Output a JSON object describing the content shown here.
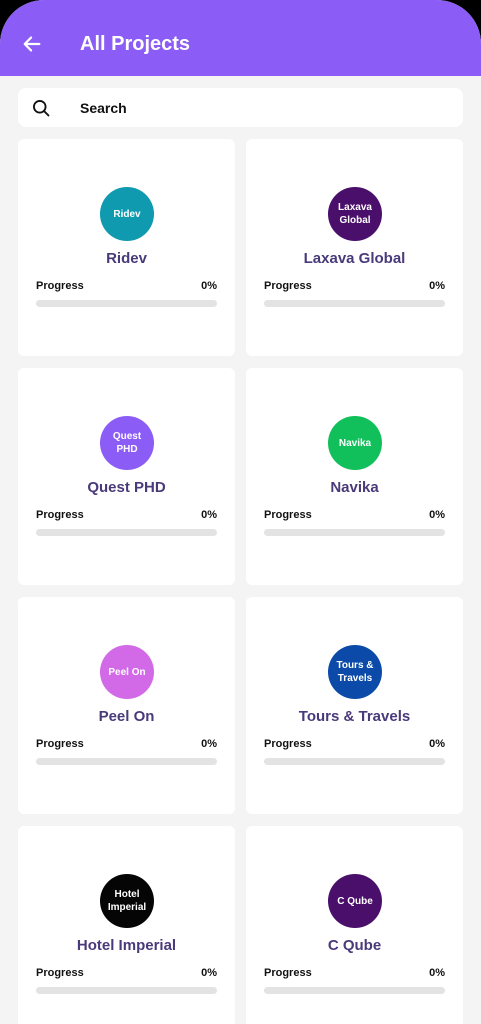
{
  "header": {
    "title": "All Projects"
  },
  "search": {
    "placeholder": "Search",
    "value": ""
  },
  "projects": [
    {
      "avatar_text": "Ridev",
      "name": "Ridev",
      "progress_label": "Progress",
      "progress_text": "0%",
      "progress": 0,
      "color": "#0f9aaf"
    },
    {
      "avatar_text": "Laxava Global",
      "name": "Laxava Global",
      "progress_label": "Progress",
      "progress_text": "0%",
      "progress": 0,
      "color": "#4a0f6b"
    },
    {
      "avatar_text": "Quest PHD",
      "name": "Quest PHD",
      "progress_label": "Progress",
      "progress_text": "0%",
      "progress": 0,
      "color": "#8b5cf6"
    },
    {
      "avatar_text": "Navika",
      "name": "Navika",
      "progress_label": "Progress",
      "progress_text": "0%",
      "progress": 0,
      "color": "#12c05b"
    },
    {
      "avatar_text": "Peel On",
      "name": "Peel On",
      "progress_label": "Progress",
      "progress_text": "0%",
      "progress": 0,
      "color": "#d26ae8"
    },
    {
      "avatar_text": "Tours & Travels",
      "name": "Tours & Travels",
      "progress_label": "Progress",
      "progress_text": "0%",
      "progress": 0,
      "color": "#0b4aa8"
    },
    {
      "avatar_text": "Hotel Imperial",
      "name": "Hotel Imperial",
      "progress_label": "Progress",
      "progress_text": "0%",
      "progress": 0,
      "color": "#050505"
    },
    {
      "avatar_text": "C Qube",
      "name": "C Qube",
      "progress_label": "Progress",
      "progress_text": "0%",
      "progress": 0,
      "color": "#4a0f6b"
    }
  ],
  "icons": {
    "back": "arrow-left-icon",
    "search": "search-icon"
  },
  "colors": {
    "accent": "#8b5cf6",
    "name_text": "#4a3a7a",
    "track": "#e3e3e3"
  }
}
